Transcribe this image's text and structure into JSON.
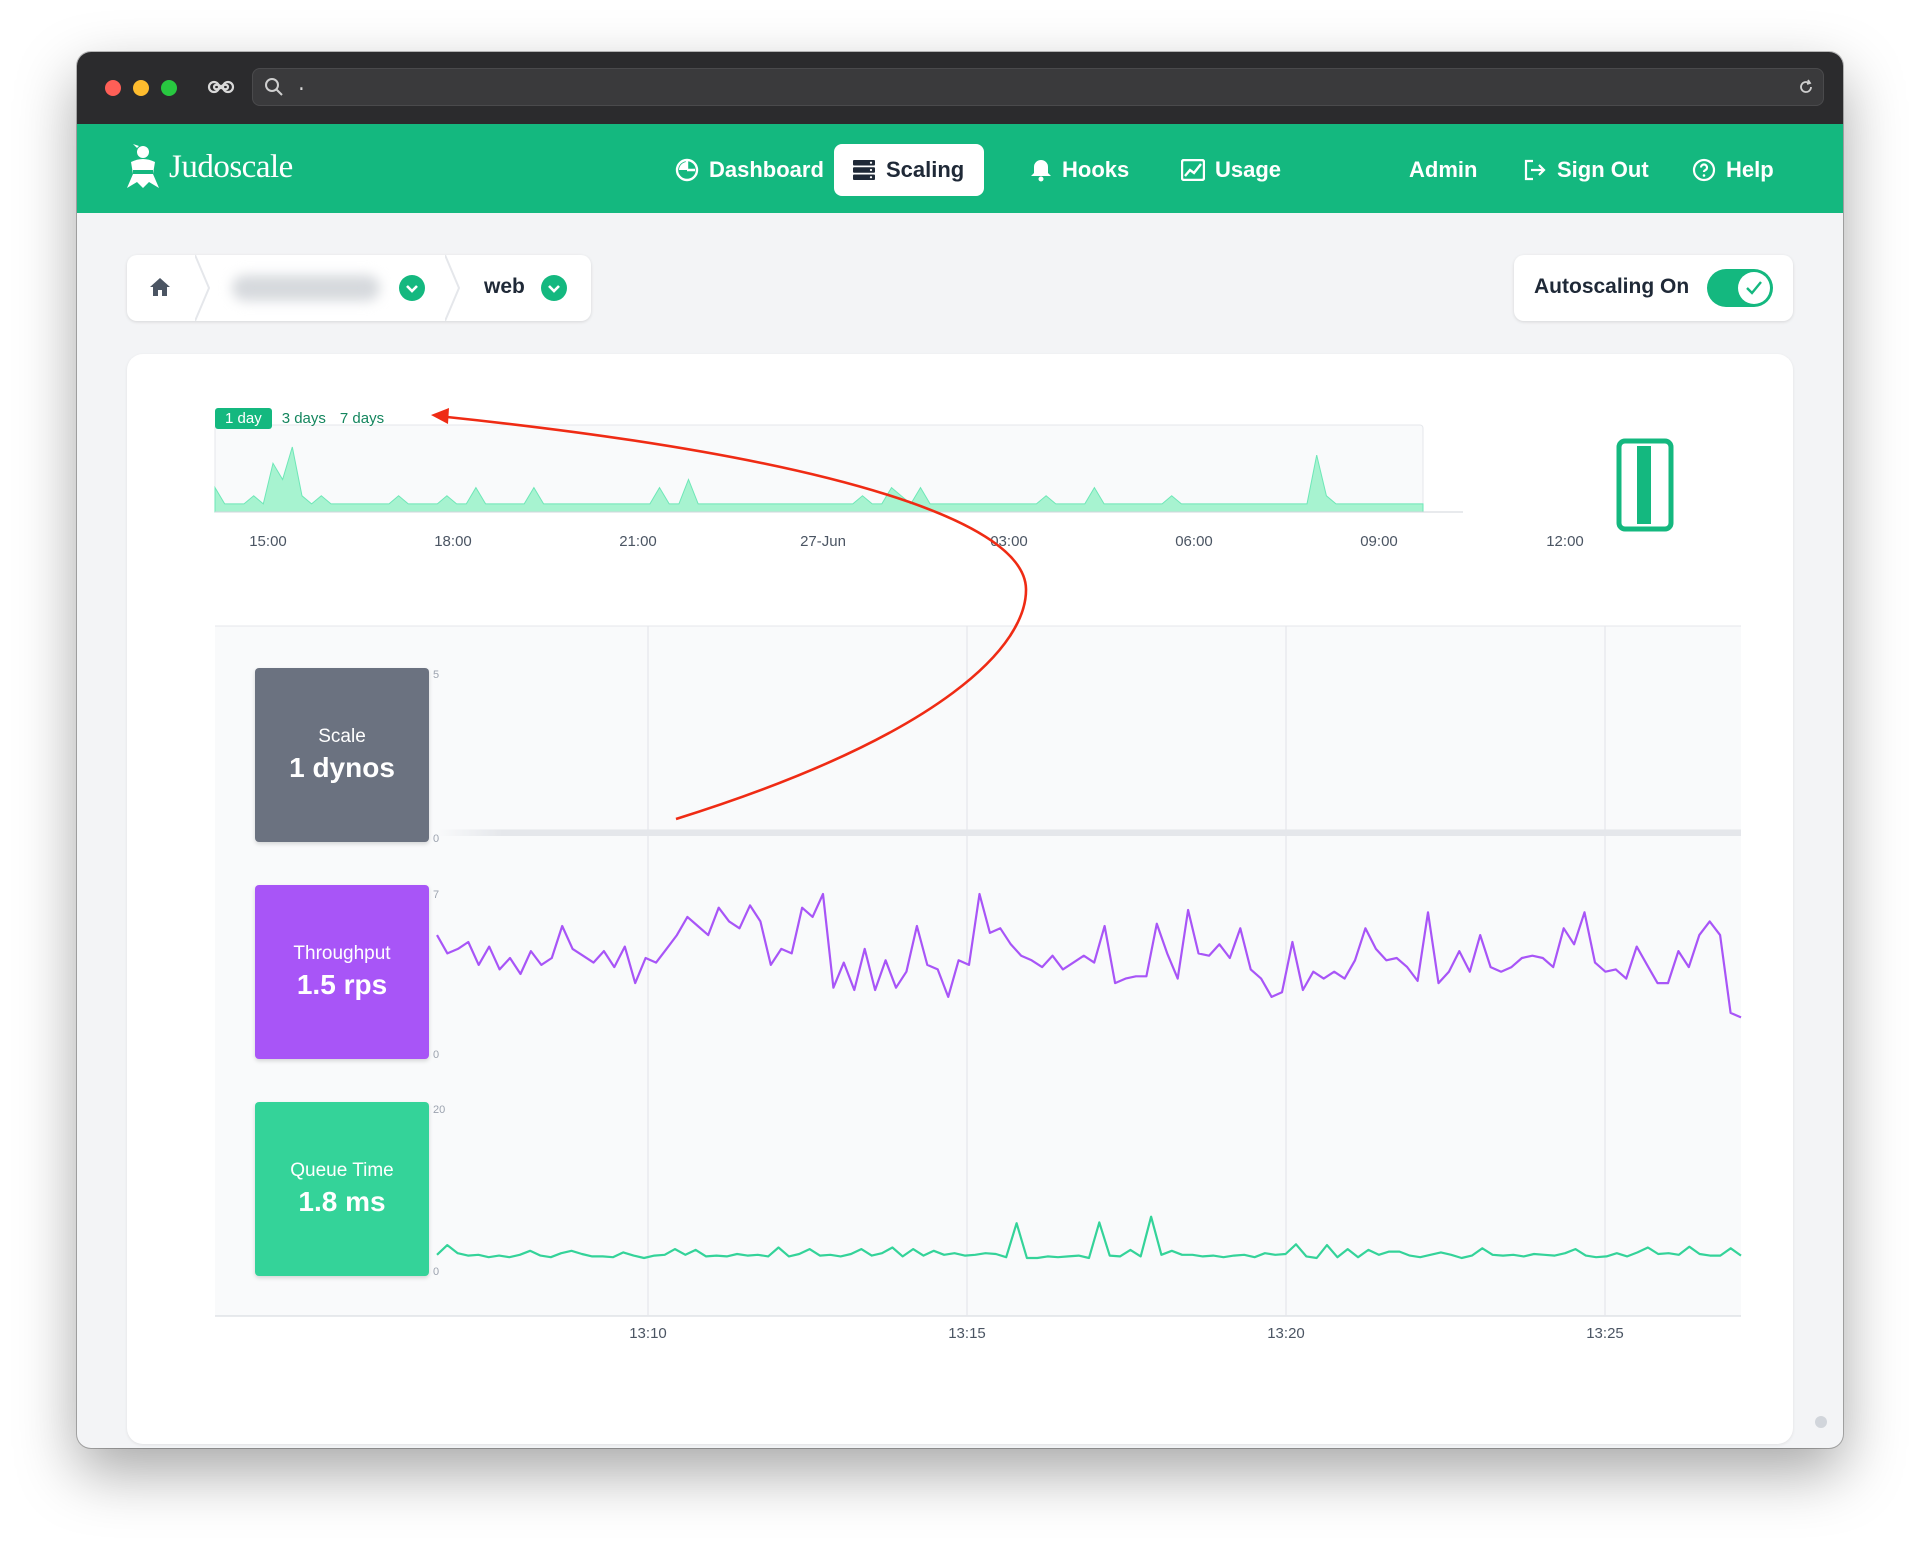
{
  "browser": {
    "url_text": "."
  },
  "nav": {
    "brand": "Judoscale",
    "items": [
      {
        "label": "Dashboard",
        "icon": "gauge-icon"
      },
      {
        "label": "Scaling",
        "icon": "server-stack-icon",
        "active": true
      },
      {
        "label": "Hooks",
        "icon": "bell-icon"
      },
      {
        "label": "Usage",
        "icon": "line-chart-icon"
      }
    ],
    "admin": "Admin",
    "sign_out": "Sign Out",
    "help": "Help"
  },
  "breadcrumb": {
    "app_name_blurred": "",
    "process": "web"
  },
  "autoscaling": {
    "label": "Autoscaling On",
    "enabled": true
  },
  "range_selector": {
    "options": [
      "1 day",
      "3 days",
      "7 days"
    ],
    "selected": "1 day"
  },
  "metrics": {
    "scale": {
      "label": "Scale",
      "value": "1 dynos",
      "color": "#6b7280"
    },
    "throughput": {
      "label": "Throughput",
      "value": "1.5 rps",
      "color": "#a855f7"
    },
    "queue_time": {
      "label": "Queue Time",
      "value": "1.8 ms",
      "color": "#34d399"
    }
  },
  "colors": {
    "brand": "#14b87f",
    "annotation_arrow": "#ef2b14"
  },
  "chart_data": [
    {
      "type": "area",
      "name": "overview",
      "x_ticks": [
        "15:00",
        "18:00",
        "21:00",
        "27-Jun",
        "03:00",
        "06:00",
        "09:00",
        "12:00"
      ],
      "values": [
        3,
        1,
        1,
        1,
        2,
        1,
        6,
        4,
        8,
        2,
        1,
        2,
        1,
        1,
        1,
        1,
        1,
        1,
        1,
        2,
        1,
        1,
        1,
        1,
        2,
        1,
        1,
        3,
        1,
        1,
        1,
        1,
        1,
        3,
        1,
        1,
        1,
        1,
        1,
        1,
        1,
        1,
        1,
        1,
        1,
        1,
        3,
        1,
        1,
        4,
        1,
        1,
        1,
        1,
        1,
        1,
        1,
        1,
        1,
        1,
        1,
        1,
        1,
        1,
        1,
        1,
        1,
        2,
        1,
        1,
        3,
        2,
        1,
        3,
        1,
        1,
        1,
        1,
        1,
        1,
        1,
        1,
        1,
        1,
        1,
        1,
        2,
        1,
        1,
        1,
        1,
        3,
        1,
        1,
        1,
        1,
        1,
        1,
        1,
        2,
        1,
        1,
        1,
        1,
        1,
        1,
        1,
        1,
        1,
        1,
        1,
        1,
        1,
        1,
        7,
        2,
        1,
        1,
        1,
        1,
        1,
        1,
        1,
        1,
        1,
        1
      ]
    },
    {
      "type": "area",
      "name": "Scale",
      "ylim": [
        0,
        5
      ],
      "y_ticks": [
        "5",
        "0"
      ],
      "values": [
        1,
        1,
        1,
        1,
        1,
        1,
        1,
        1,
        1,
        1,
        1,
        1,
        1,
        1,
        1,
        1,
        1,
        1,
        1,
        1
      ]
    },
    {
      "type": "line",
      "name": "Throughput",
      "ylim": [
        0,
        7
      ],
      "y_ticks": [
        "7",
        "0"
      ],
      "values": [
        5.2,
        4.4,
        4.6,
        4.9,
        3.9,
        4.7,
        3.7,
        4.2,
        3.5,
        4.5,
        3.9,
        4.2,
        5.6,
        4.6,
        4.3,
        4.0,
        4.5,
        3.8,
        4.7,
        3.1,
        4.2,
        4.0,
        4.6,
        5.2,
        6.0,
        5.6,
        5.2,
        6.4,
        5.8,
        5.5,
        6.5,
        5.8,
        3.9,
        4.6,
        4.4,
        6.4,
        6.0,
        7.0,
        2.9,
        4.0,
        2.8,
        4.6,
        2.8,
        4.1,
        2.9,
        3.6,
        5.6,
        3.9,
        3.7,
        2.5,
        4.1,
        3.9,
        7.0,
        5.3,
        5.5,
        4.8,
        4.3,
        4.1,
        3.8,
        4.3,
        3.7,
        4.0,
        4.3,
        4.0,
        5.6,
        3.1,
        3.3,
        3.4,
        3.4,
        5.7,
        4.4,
        3.3,
        6.3,
        4.4,
        4.3,
        4.8,
        4.2,
        5.5,
        3.7,
        3.3,
        2.5,
        2.7,
        4.9,
        2.8,
        3.6,
        3.3,
        3.6,
        3.3,
        4.1,
        5.5,
        4.6,
        4.1,
        4.2,
        3.8,
        3.2,
        6.2,
        3.1,
        3.6,
        4.5,
        3.6,
        5.2,
        3.8,
        3.6,
        3.8,
        4.2,
        4.3,
        4.2,
        3.8,
        5.5,
        4.8,
        6.2,
        4.0,
        3.6,
        3.7,
        3.3,
        4.7,
        3.9,
        3.1,
        3.1,
        4.5,
        3.8,
        5.2,
        5.8,
        5.2,
        1.8,
        1.6
      ]
    },
    {
      "type": "line",
      "name": "Queue Time",
      "ylim": [
        0,
        20
      ],
      "y_ticks": [
        "20",
        "0"
      ],
      "values": [
        2.0,
        3.2,
        2.2,
        1.9,
        2.0,
        1.7,
        1.9,
        1.7,
        2.0,
        2.5,
        1.9,
        1.7,
        2.2,
        2.5,
        2.1,
        1.8,
        1.8,
        1.7,
        2.3,
        1.9,
        1.6,
        1.9,
        2.0,
        2.7,
        2.0,
        2.6,
        1.8,
        1.9,
        1.8,
        2.1,
        1.9,
        2.0,
        1.8,
        2.9,
        1.8,
        2.1,
        2.7,
        1.9,
        2.0,
        1.8,
        2.1,
        2.7,
        1.9,
        2.2,
        2.9,
        1.8,
        2.7,
        1.9,
        2.5,
        2.0,
        2.2,
        1.9,
        2.0,
        2.2,
        2.1,
        1.7,
        5.9,
        1.6,
        1.6,
        1.8,
        1.7,
        1.8,
        1.9,
        1.6,
        6.0,
        1.9,
        1.8,
        2.6,
        1.8,
        6.7,
        2.0,
        2.5,
        2.0,
        2.0,
        1.8,
        1.9,
        1.7,
        1.9,
        2.0,
        1.7,
        2.2,
        2.0,
        2.1,
        3.3,
        1.8,
        1.6,
        3.2,
        1.7,
        2.7,
        1.7,
        2.6,
        2.0,
        2.4,
        2.4,
        1.9,
        1.7,
        2.0,
        2.3,
        2.0,
        1.6,
        1.9,
        2.8,
        2.0,
        1.9,
        2.0,
        1.8,
        2.1,
        2.0,
        1.9,
        2.2,
        2.7,
        1.9,
        1.7,
        1.8,
        2.2,
        1.8,
        2.3,
        2.9,
        2.1,
        2.2,
        2.0,
        3.0,
        2.1,
        1.9,
        1.9,
        2.8,
        1.9
      ]
    }
  ],
  "time_axis": [
    "13:10",
    "13:15",
    "13:20",
    "13:25"
  ]
}
